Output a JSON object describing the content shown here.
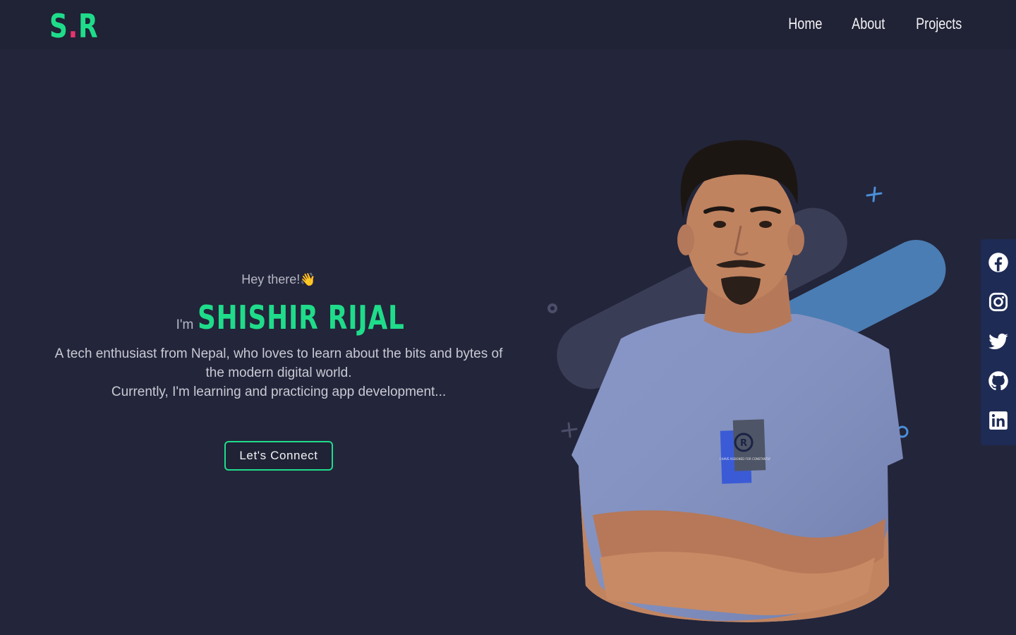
{
  "header": {
    "logo": {
      "left": "S",
      "dot": ".",
      "right": "R"
    },
    "nav": [
      {
        "label": "Home"
      },
      {
        "label": "About"
      },
      {
        "label": "Projects"
      }
    ]
  },
  "hero": {
    "greeting": "Hey there!",
    "wave_emoji": "👋",
    "im": "I'm",
    "name": "SHISHIR RIJAL",
    "description_line1": "A tech enthusiast from Nepal, who loves to learn about the bits and bytes of the modern digital world.",
    "description_line2": "Currently, I'm learning and practicing app development...",
    "cta_label": "Let's Connect"
  },
  "portrait": {
    "shirt_badge_text": "I HAVE ASSIGNED FOR CONSTANTLY"
  },
  "social": [
    {
      "icon": "facebook-icon"
    },
    {
      "icon": "instagram-icon"
    },
    {
      "icon": "twitter-icon"
    },
    {
      "icon": "github-icon"
    },
    {
      "icon": "linkedin-icon"
    }
  ],
  "colors": {
    "background": "#23253a",
    "header": "#202235",
    "accent": "#1fdc8a",
    "logo_dot": "#e8336e",
    "decor_blue": "#4a7db3",
    "decor_gray": "#3a3d56",
    "social_bar": "#1e2b55"
  }
}
